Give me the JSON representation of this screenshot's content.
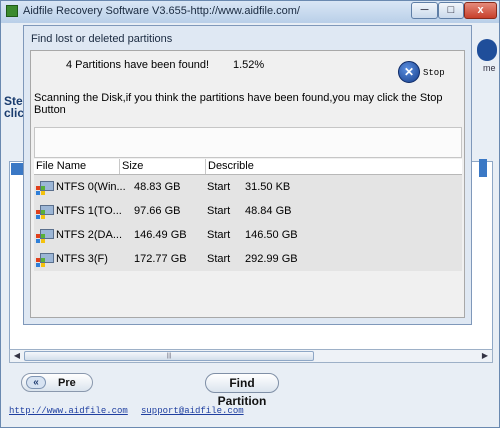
{
  "window": {
    "title": "Aidfile Recovery Software V3.655-http://www.aidfile.com/",
    "minimize_glyph": "─",
    "maximize_glyph": "□",
    "close_glyph": "x"
  },
  "background": {
    "step_line1": "Step",
    "step_line2": "clic",
    "me_label": "me",
    "scroll_left": "◀",
    "scroll_right": "▶",
    "scroll_grip": "|||"
  },
  "dialog": {
    "title": "Find lost or deleted partitions",
    "found_text": "4 Partitions have been found!",
    "progress_percent": "1.52%",
    "stop_label": "Stop",
    "stop_glyph": "✕",
    "scan_message": "Scanning the Disk,if you think the partitions have been found,you may click the Stop Button",
    "columns": {
      "file_name": "File Name",
      "size": "Size",
      "describle": "Describle"
    },
    "partitions": [
      {
        "name": "NTFS 0(Win...",
        "size": "48.83 GB",
        "start_label": "Start",
        "start": "31.50 KB"
      },
      {
        "name": "NTFS 1(TO...",
        "size": "97.66 GB",
        "start_label": "Start",
        "start": "48.84 GB"
      },
      {
        "name": "NTFS 2(DA...",
        "size": "146.49 GB",
        "start_label": "Start",
        "start": "146.50 GB"
      },
      {
        "name": "NTFS 3(F)",
        "size": "172.77 GB",
        "start_label": "Start",
        "start": "292.99 GB"
      }
    ]
  },
  "footer": {
    "pre_label": "Pre",
    "pre_glyph": "«",
    "find_partition_label": "Find Partition",
    "website_link": "http://www.aidfile.com",
    "support_link": "support@aidfile.com"
  },
  "icons": [
    "app-icon",
    "stop-icon",
    "partition-drive-icon",
    "double-left-arrow-icon"
  ]
}
